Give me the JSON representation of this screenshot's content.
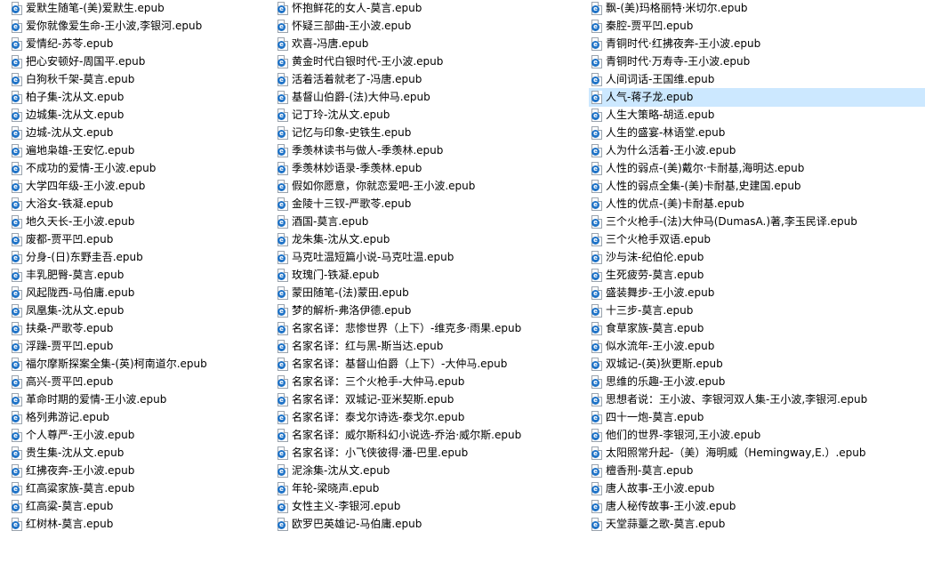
{
  "icon": {
    "name": "epub-file-icon",
    "badge": "e",
    "accent": "#1f73c7"
  },
  "selection_color": "#cce8ff",
  "columns": [
    [
      "爱默生随笔-(美)爱默生.epub",
      "爱你就像爱生命-王小波,李银河.epub",
      "爱情纪-苏苓.epub",
      "把心安顿好-周国平.epub",
      "白狗秋千架-莫言.epub",
      "柏子集-沈从文.epub",
      "边城集-沈从文.epub",
      "边城-沈从文.epub",
      "遍地枭雄-王安忆.epub",
      "不成功的爱情-王小波.epub",
      "大学四年级-王小波.epub",
      "大浴女-铁凝.epub",
      "地久天长-王小波.epub",
      "废都-贾平凹.epub",
      "分身-(日)东野圭吾.epub",
      "丰乳肥臀-莫言.epub",
      "风起陇西-马伯庸.epub",
      "凤凰集-沈从文.epub",
      "扶桑-严歌苓.epub",
      "浮躁-贾平凹.epub",
      "福尔摩斯探案全集-(英)柯南道尔.epub",
      "高兴-贾平凹.epub",
      "革命时期的爱情-王小波.epub",
      "格列弗游记.epub",
      "个人尊严-王小波.epub",
      "贵生集-沈从文.epub",
      "红拂夜奔-王小波.epub",
      "红高粱家族-莫言.epub",
      "红高粱-莫言.epub",
      "红树林-莫言.epub"
    ],
    [
      "怀抱鲜花的女人-莫言.epub",
      "怀疑三部曲-王小波.epub",
      "欢喜-冯唐.epub",
      "黄金时代白银时代-王小波.epub",
      "活着活着就老了-冯唐.epub",
      "基督山伯爵-(法)大仲马.epub",
      "记丁玲-沈从文.epub",
      "记忆与印象-史铁生.epub",
      "季羡林读书与做人-季羡林.epub",
      "季羡林妙语录-季羡林.epub",
      "假如你愿意，你就恋爱吧-王小波.epub",
      "金陵十三钗-严歌苓.epub",
      "酒国-莫言.epub",
      "龙朱集-沈从文.epub",
      "马克吐温短篇小说-马克吐温.epub",
      "玫瑰门-铁凝.epub",
      "蒙田随笔-(法)蒙田.epub",
      "梦的解析-弗洛伊德.epub",
      "名家名译：悲惨世界（上下）-维克多·雨果.epub",
      "名家名译：红与黑-斯当达.epub",
      "名家名译：基督山伯爵（上下）-大仲马.epub",
      "名家名译：三个火枪手-大仲马.epub",
      "名家名译：双城记-亚米契斯.epub",
      "名家名译：泰戈尔诗选-泰戈尔.epub",
      "名家名译：威尔斯科幻小说选-乔治·威尔斯.epub",
      "名家名译：小飞侠彼得·潘-巴里.epub",
      "泥涂集-沈从文.epub",
      "年轮-梁晓声.epub",
      "女性主义-李银河.epub",
      "欧罗巴英雄记-马伯庸.epub"
    ],
    [
      "飘-(美)玛格丽特·米切尔.epub",
      "秦腔-贾平凹.epub",
      "青铜时代·红拂夜奔-王小波.epub",
      "青铜时代·万寿寺-王小波.epub",
      "人间词话-王国维.epub",
      "人气-蒋子龙.epub",
      "人生大策略-胡适.epub",
      "人生的盛宴-林语堂.epub",
      "人为什么活着-王小波.epub",
      "人性的弱点-(美)戴尔·卡耐基,海明达.epub",
      "人性的弱点全集-(美)卡耐基,史建国.epub",
      "人性的优点-(美)卡耐基.epub",
      "三个火枪手-(法)大仲马(DumasA.)著,李玉民译.epub",
      "三个火枪手双语.epub",
      "沙与沫-纪伯伦.epub",
      "生死疲劳-莫言.epub",
      "盛装舞步-王小波.epub",
      "十三步-莫言.epub",
      "食草家族-莫言.epub",
      "似水流年-王小波.epub",
      "双城记-(英)狄更斯.epub",
      "思维的乐趣-王小波.epub",
      "思想者说：王小波、李银河双人集-王小波,李银河.epub",
      "四十一炮-莫言.epub",
      "他们的世界-李银河,王小波.epub",
      "太阳照常升起-（美）海明威（Hemingway,E.）.epub",
      "檀香刑-莫言.epub",
      "唐人故事-王小波.epub",
      "唐人秘传故事-王小波.epub",
      "天堂蒜薹之歌-莫言.epub"
    ]
  ],
  "selected": {
    "column": 2,
    "row": 5
  }
}
